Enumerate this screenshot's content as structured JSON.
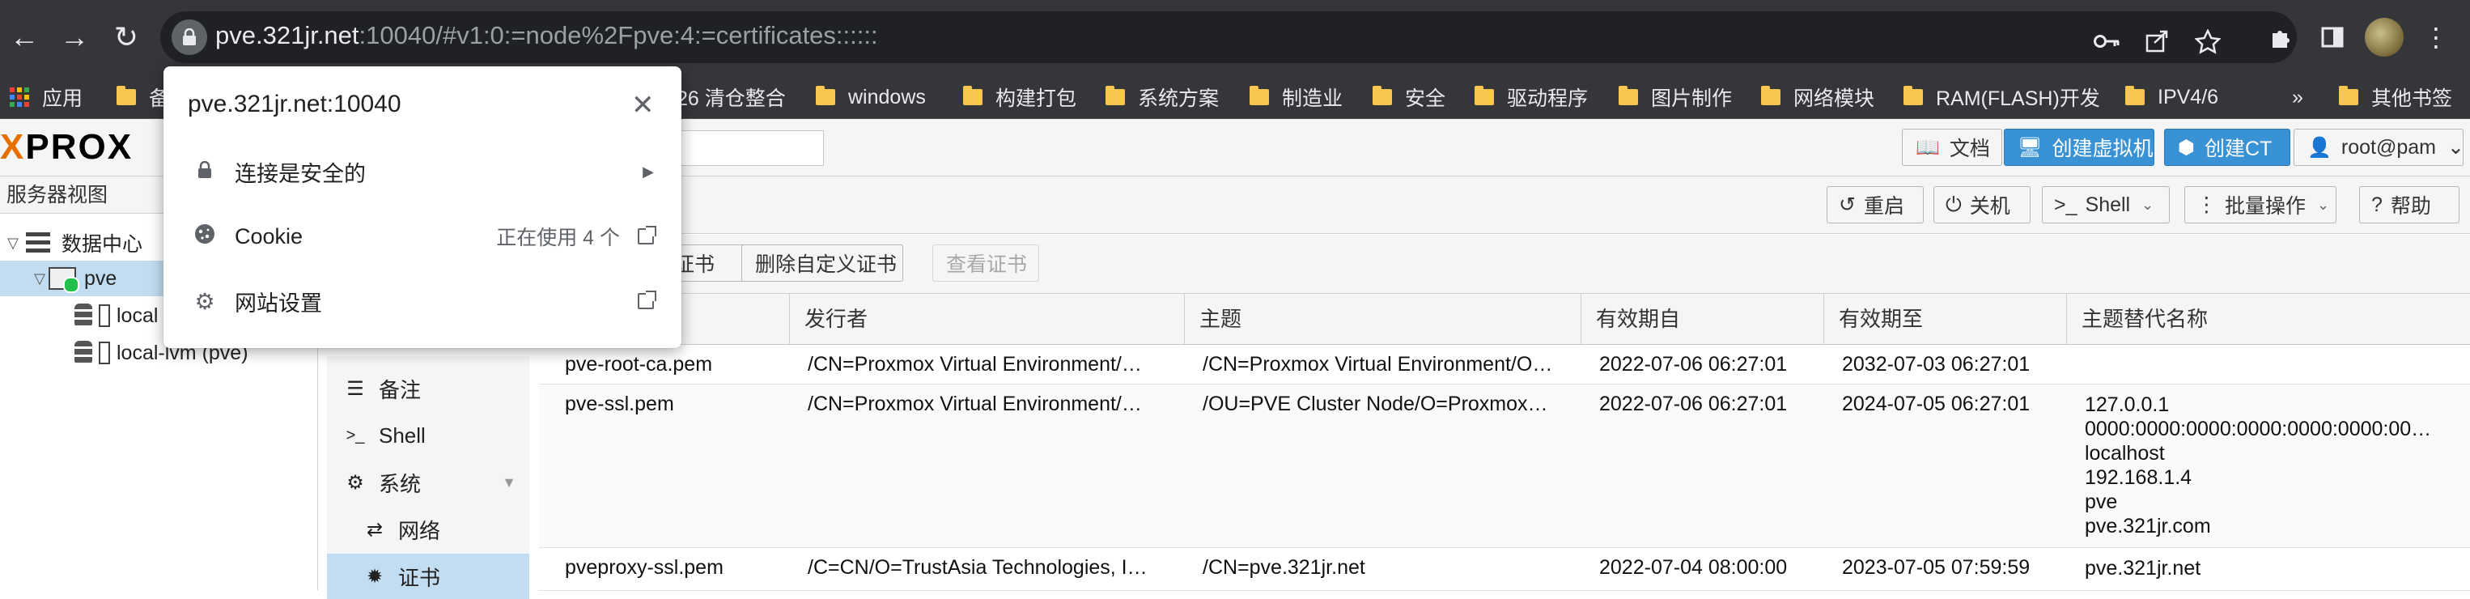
{
  "browser": {
    "url_host": "pve.321jr.net",
    "url_rest": ":10040/#v1:0:=node%2Fpve:4:=certificates::::::"
  },
  "bookmarks": {
    "apps_label": "应用",
    "items": [
      "备",
      "26 清仓整合",
      "windows",
      "构建打包",
      "系统方案",
      "制造业",
      "安全",
      "驱动程序",
      "图片制作",
      "网络模块",
      "RAM(FLASH)开发",
      "IPV4/6"
    ],
    "more_label": "»",
    "other_label": "其他书签"
  },
  "site_popup": {
    "title": "pve.321jr.net:10040",
    "close_label": "✕",
    "rows": [
      {
        "label": "连接是安全的"
      },
      {
        "label": "Cookie",
        "right": "正在使用 4 个"
      },
      {
        "label": "网站设置"
      }
    ]
  },
  "pve_header": {
    "logo_x": "X",
    "logo_text": "PROX",
    "docs_label": "文档",
    "create_vm_label": "创建虚拟机",
    "create_ct_label": "创建CT",
    "user_label": "root@pam"
  },
  "server_view": {
    "title": "服务器视图",
    "tree": [
      {
        "label": "数据中心"
      },
      {
        "label": "pve"
      },
      {
        "label": "local"
      },
      {
        "label": "local-lvm (pve)"
      }
    ]
  },
  "node_toolbar": {
    "reboot_label": "重启",
    "shutdown_label": "关机",
    "shell_label": "Shell",
    "bulk_label": "批量操作",
    "help_label": "帮助"
  },
  "node_menu": {
    "items": [
      {
        "label": "备注"
      },
      {
        "label": "Shell"
      },
      {
        "label": "系统"
      },
      {
        "label": "网络"
      },
      {
        "label": "证书"
      }
    ]
  },
  "cert_toolbar": {
    "upload_label": "证书",
    "delete_label": "删除自定义证书",
    "view_label": "查看证书"
  },
  "cert_table": {
    "columns": [
      "发行者",
      "主题",
      "有效期自",
      "有效期至",
      "主题替代名称"
    ],
    "rows": [
      {
        "file": "pve-root-ca.pem",
        "issuer": "/CN=Proxmox Virtual Environment/…",
        "subject": "/CN=Proxmox Virtual Environment/O…",
        "from": "2022-07-06 06:27:01",
        "to": "2032-07-03 06:27:01",
        "san": []
      },
      {
        "file": "pve-ssl.pem",
        "issuer": "/CN=Proxmox Virtual Environment/…",
        "subject": "/OU=PVE Cluster Node/O=Proxmox…",
        "from": "2022-07-06 06:27:01",
        "to": "2024-07-05 06:27:01",
        "san": [
          "127.0.0.1",
          "0000:0000:0000:0000:0000:0000:00…",
          "localhost",
          "192.168.1.4",
          "pve",
          "pve.321jr.com"
        ]
      },
      {
        "file": "pveproxy-ssl.pem",
        "issuer": "/C=CN/O=TrustAsia Technologies, I…",
        "subject": "/CN=pve.321jr.net",
        "from": "2022-07-04 08:00:00",
        "to": "2023-07-05 07:59:59",
        "san": [
          "pve.321jr.net"
        ]
      }
    ]
  }
}
